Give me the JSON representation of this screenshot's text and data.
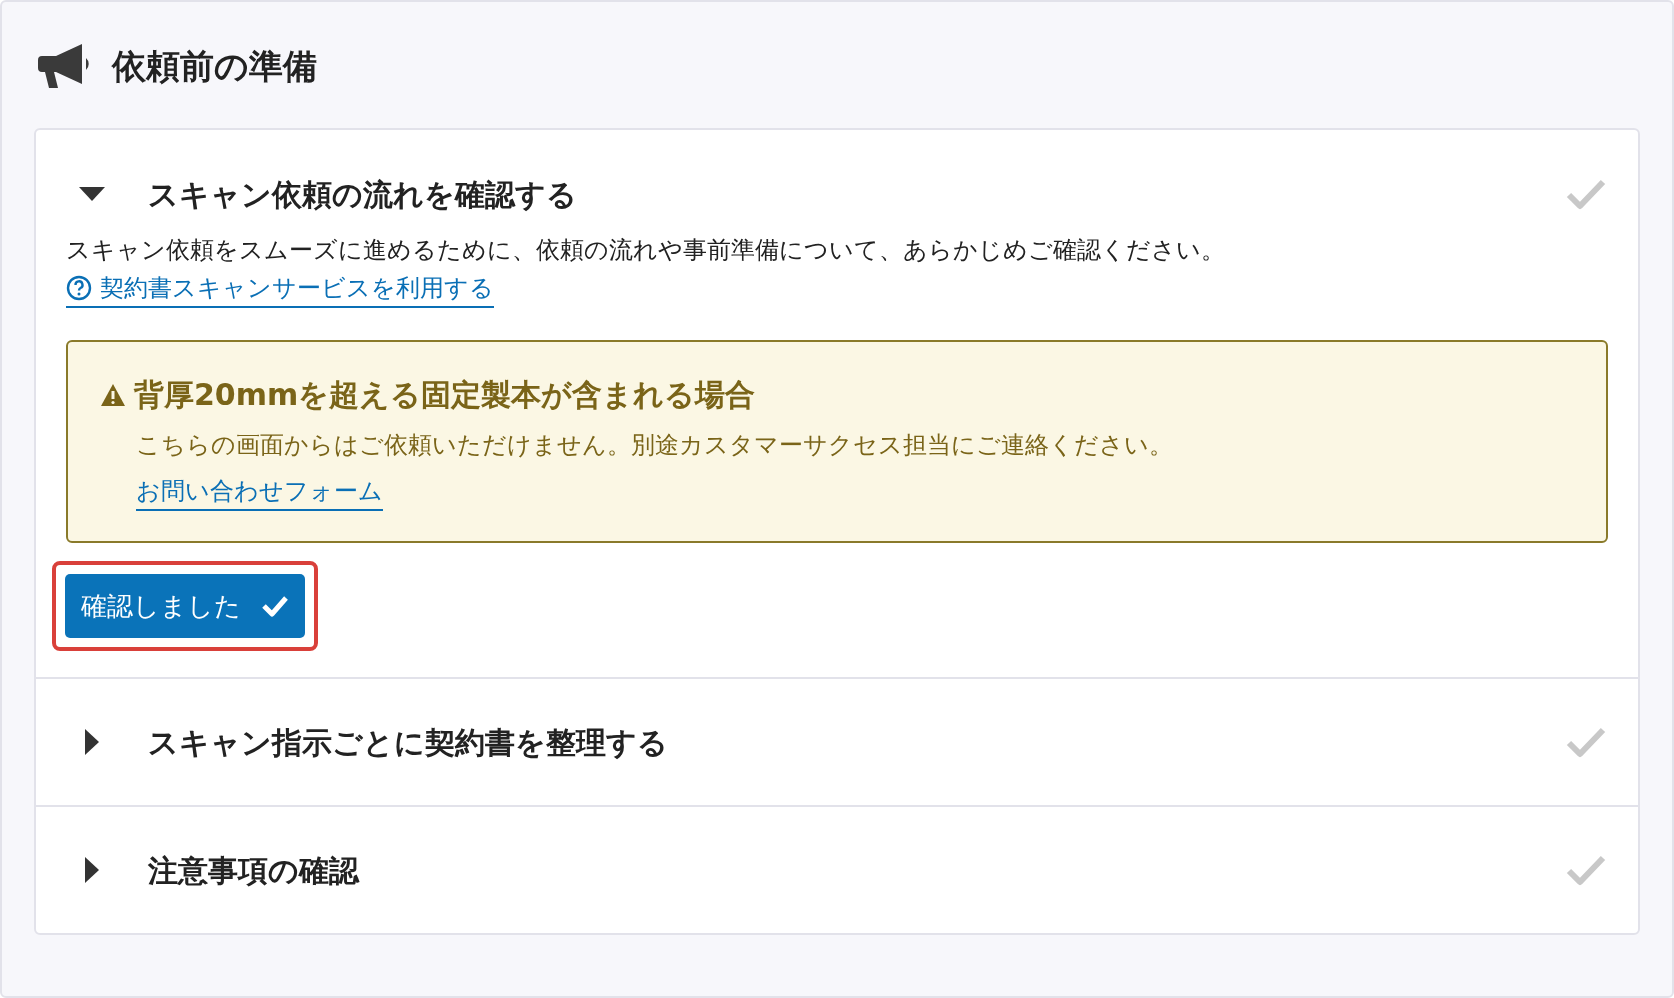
{
  "header": {
    "title": "依頼前の準備"
  },
  "sections": [
    {
      "title": "スキャン依頼の流れを確認する",
      "expanded": true,
      "description": "スキャン依頼をスムーズに進めるために、依頼の流れや事前準備について、あらかじめご確認ください。",
      "help_link": "契約書スキャンサービスを利用する",
      "notice": {
        "title": "背厚20mmを超える固定製本が含まれる場合",
        "body": "こちらの画面からはご依頼いただけません。別途カスタマーサクセス担当にご連絡ください。",
        "link": "お問い合わせフォーム"
      },
      "confirm_button": "確認しました"
    },
    {
      "title": "スキャン指示ごとに契約書を整理する",
      "expanded": false
    },
    {
      "title": "注意事項の確認",
      "expanded": false
    }
  ]
}
